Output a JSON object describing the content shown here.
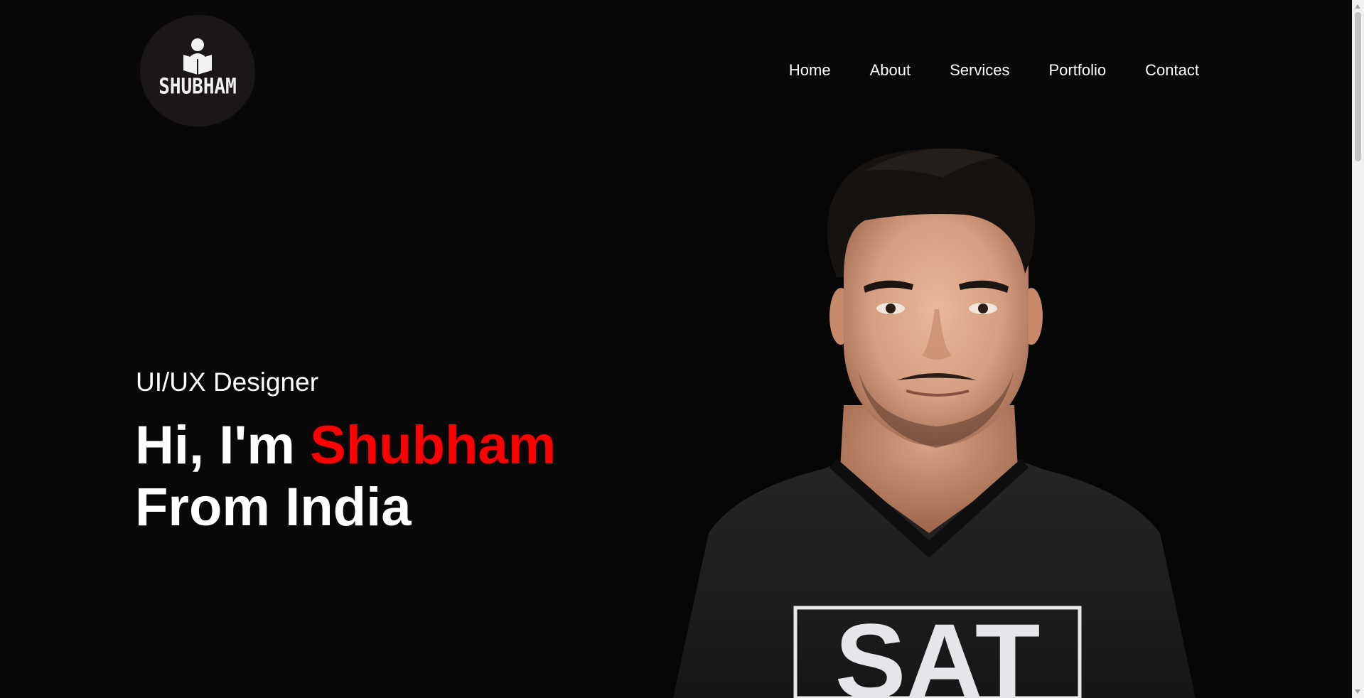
{
  "logo": {
    "text": "SHUBHAM",
    "icon": "person-reading-icon"
  },
  "nav": {
    "items": [
      {
        "label": "Home"
      },
      {
        "label": "About"
      },
      {
        "label": "Services"
      },
      {
        "label": "Portfolio"
      },
      {
        "label": "Contact"
      }
    ]
  },
  "hero": {
    "subtitle": "UI/UX Designer",
    "greeting": "Hi, I'm",
    "name": "Shubham",
    "line2": "From India",
    "portrait_shirt_text": "SAT",
    "colors": {
      "background": "#080808",
      "accent": "#ff0000",
      "text": "#ffffff"
    }
  }
}
